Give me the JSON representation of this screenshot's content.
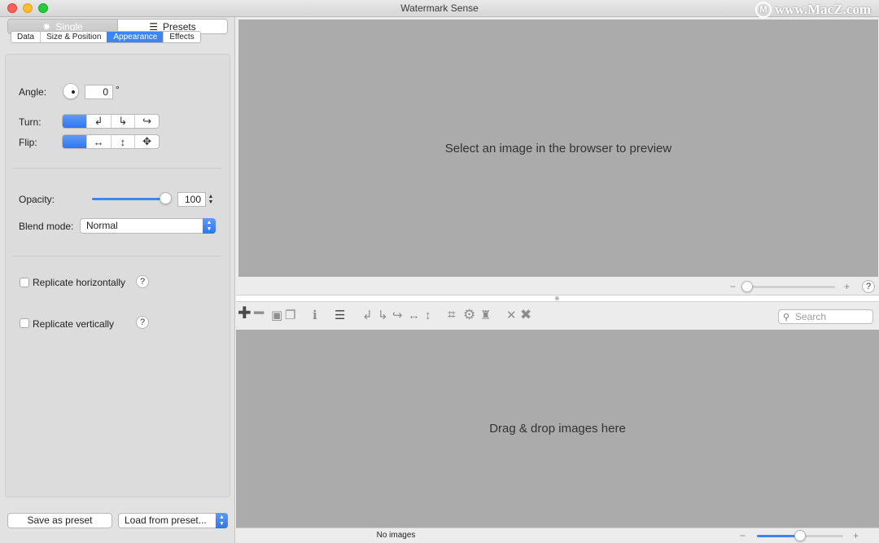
{
  "window": {
    "title": "Watermark Sense",
    "watermark_text": "www.MacZ.com",
    "watermark_logo": "M"
  },
  "mode": {
    "single_label": "Single",
    "presets_label": "Presets"
  },
  "tabs": [
    {
      "label": "Data"
    },
    {
      "label": "Size & Position"
    },
    {
      "label": "Appearance"
    },
    {
      "label": "Effects"
    }
  ],
  "appearance": {
    "angle_label": "Angle:",
    "angle_value": "0",
    "angle_unit": "°",
    "turn_label": "Turn:",
    "flip_label": "Flip:",
    "opacity_label": "Opacity:",
    "opacity_value": "100",
    "opacity_level": 1.0,
    "blend_label": "Blend mode:",
    "blend_value": "Normal",
    "replicate_h_label": "Replicate horizontally",
    "replicate_v_label": "Replicate vertically",
    "help_glyph": "?"
  },
  "bottom": {
    "save_label": "Save as preset",
    "load_label": "Load from preset..."
  },
  "preview": {
    "placeholder": "Select an image in the browser to preview"
  },
  "browser": {
    "placeholder": "Drag & drop images here",
    "search_placeholder": "Search"
  },
  "status": {
    "text": "No images"
  },
  "zoom": {
    "minus": "−",
    "plus": "+",
    "preview_level": 0.0,
    "browser_level": 0.5
  },
  "colors": {
    "accent": "#3b85f5",
    "canvas": "#ababab"
  }
}
